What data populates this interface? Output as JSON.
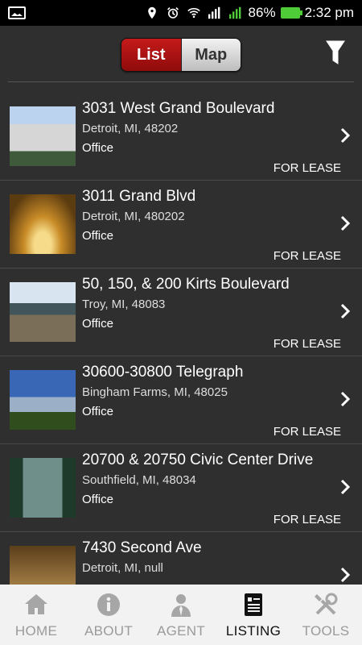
{
  "status_bar": {
    "battery": "86%",
    "time": "2:32 pm"
  },
  "header": {
    "tabs": [
      {
        "label": "List",
        "active": true
      },
      {
        "label": "Map",
        "active": false
      }
    ],
    "filter_icon": "filter-icon"
  },
  "listings": [
    {
      "title": "3031 West Grand Boulevard",
      "location": "Detroit, MI, 48202",
      "type": "Office",
      "status": "FOR LEASE"
    },
    {
      "title": "3011 Grand Blvd",
      "location": "Detroit, MI, 480202",
      "type": "Office",
      "status": "FOR LEASE"
    },
    {
      "title": "50, 150, & 200 Kirts Boulevard",
      "location": "Troy, MI, 48083",
      "type": "Office",
      "status": "FOR LEASE"
    },
    {
      "title": "30600-30800 Telegraph",
      "location": "Bingham Farms, MI, 48025",
      "type": "Office",
      "status": "FOR LEASE"
    },
    {
      "title": "20700 & 20750 Civic Center Drive",
      "location": "Southfield, MI, 48034",
      "type": "Office",
      "status": "FOR LEASE"
    },
    {
      "title": "7430 Second Ave",
      "location": "Detroit, MI, null",
      "type": "",
      "status": ""
    }
  ],
  "bottom_nav": [
    {
      "label": "HOME",
      "icon": "home-icon",
      "active": false
    },
    {
      "label": "ABOUT",
      "icon": "info-icon",
      "active": false
    },
    {
      "label": "AGENT",
      "icon": "agent-icon",
      "active": false
    },
    {
      "label": "LISTING",
      "icon": "listing-icon",
      "active": true
    },
    {
      "label": "TOOLS",
      "icon": "tools-icon",
      "active": false
    }
  ],
  "colors": {
    "accent": "#b81212",
    "background": "#2f2f2f",
    "nav_bg": "#f2f2f2"
  }
}
